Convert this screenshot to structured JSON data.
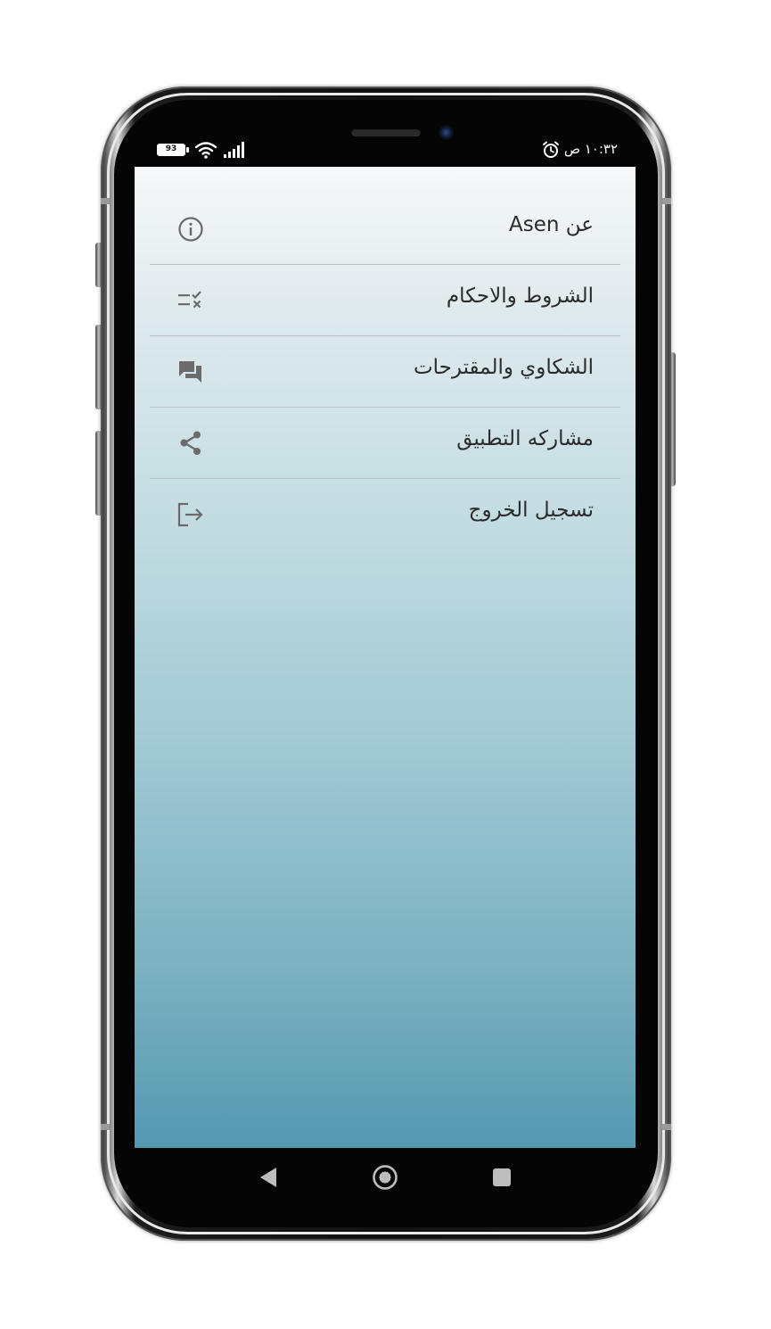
{
  "status_bar": {
    "battery_level": "93",
    "time": "١٠:٣٢ ص"
  },
  "menu": {
    "items": [
      {
        "label": "عن Asen",
        "icon": "info-icon"
      },
      {
        "label": "الشروط والاحكام",
        "icon": "terms-checklist-icon"
      },
      {
        "label": "الشكاوي والمقترحات",
        "icon": "chat-bubbles-icon"
      },
      {
        "label": "مشاركه التطبيق",
        "icon": "share-icon"
      },
      {
        "label": "تسجيل الخروج",
        "icon": "logout-icon"
      }
    ]
  },
  "nav_bar": {
    "buttons": [
      "back-icon",
      "home-icon",
      "recents-icon"
    ]
  },
  "colors": {
    "screen_top": "#f7f9fa",
    "screen_bottom": "#5599b0",
    "icon_color": "#6b6b6b",
    "text_color": "#2b2b2b"
  }
}
